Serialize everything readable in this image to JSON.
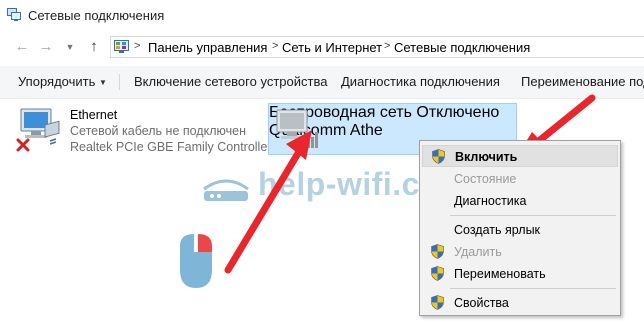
{
  "window": {
    "title": "Сетевые подключения",
    "icon": "network-connections-icon"
  },
  "nav": {
    "back_icon": "arrow-left-icon",
    "forward_icon": "arrow-right-icon",
    "dropdown_icon": "chevron-down-icon",
    "up_icon": "arrow-up-icon"
  },
  "breadcrumb": {
    "items": [
      "Панель управления",
      "Сеть и Интернет",
      "Сетевые подключения"
    ],
    "separator": ">"
  },
  "toolbar": {
    "organize": "Упорядочить",
    "organize_arrow": "▼",
    "enable_device": "Включение сетевого устройства",
    "diagnose": "Диагностика подключения",
    "rename": "Переименование подк"
  },
  "connections": [
    {
      "name": "Ethernet",
      "status": "Сетевой кабель не подключен",
      "device": "Realtek PCIe GBE Family Controller",
      "state": "disconnected"
    },
    {
      "name": "Беспроводная сеть",
      "status": "Отключено",
      "device": "Qualcomm Athe",
      "state": "disabled",
      "selected": true
    }
  ],
  "context_menu": {
    "items": [
      {
        "label": "Включить",
        "shield": true,
        "bold": true,
        "highlighted": true,
        "disabled": false
      },
      {
        "label": "Состояние",
        "shield": false,
        "bold": false,
        "highlighted": false,
        "disabled": true
      },
      {
        "label": "Диагностика",
        "shield": false,
        "bold": false,
        "highlighted": false,
        "disabled": false
      },
      {
        "label": "Создать ярлык",
        "shield": false,
        "bold": false,
        "highlighted": false,
        "disabled": false
      },
      {
        "label": "Удалить",
        "shield": true,
        "bold": false,
        "highlighted": false,
        "disabled": true
      },
      {
        "label": "Переименовать",
        "shield": true,
        "bold": false,
        "highlighted": false,
        "disabled": false
      },
      {
        "label": "Свойства",
        "shield": true,
        "bold": false,
        "highlighted": false,
        "disabled": false
      }
    ]
  },
  "watermark": {
    "text": "help-wifi.com"
  },
  "colors": {
    "selection": "#cce8ff",
    "selection_border": "#99d1ff",
    "arrow": "#e8262c",
    "shield_blue": "#2f6fc4",
    "shield_yellow": "#f5c518",
    "watermark": "#9cc3d9"
  }
}
